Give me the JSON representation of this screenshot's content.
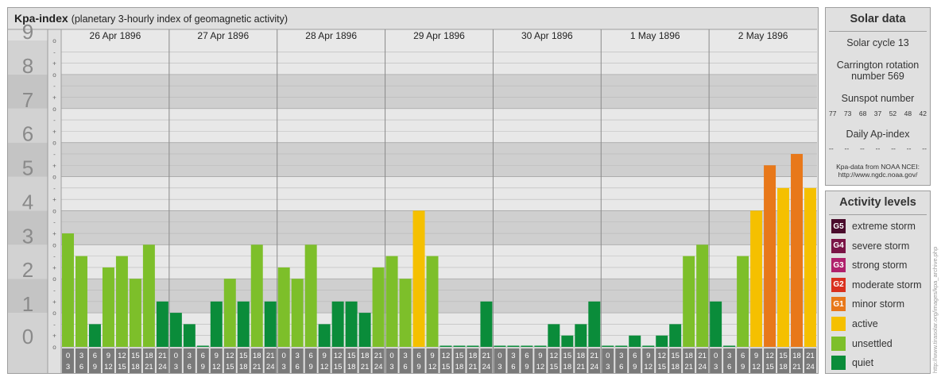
{
  "header": {
    "title": "Kpa-index",
    "subtitle": "(planetary 3-hourly index of geomagnetic activity)"
  },
  "chart_data": {
    "type": "bar",
    "title": "Kpa-index",
    "subtitle": "(planetary 3-hourly index of geomagnetic activity)",
    "ylim": [
      0,
      9
    ],
    "y_ticks": [
      "0",
      "1",
      "2",
      "3",
      "4",
      "5",
      "6",
      "7",
      "8",
      "9"
    ],
    "thirds_marks": [
      "+",
      "o",
      "-"
    ],
    "days": [
      "26 Apr 1896",
      "27 Apr 1896",
      "28 Apr 1896",
      "29 Apr 1896",
      "30 Apr 1896",
      "1 May 1896",
      "2 May 1896"
    ],
    "interval_starts": [
      "0",
      "3",
      "6",
      "9",
      "12",
      "15",
      "18",
      "21"
    ],
    "interval_ends": [
      "3",
      "6",
      "9",
      "12",
      "15",
      "18",
      "21",
      "24"
    ],
    "values": [
      [
        3.333,
        2.667,
        0.667,
        2.333,
        2.667,
        2.0,
        3.0,
        1.333
      ],
      [
        1.0,
        0.667,
        0.0,
        1.333,
        2.0,
        1.333,
        3.0,
        1.333
      ],
      [
        2.333,
        2.0,
        3.0,
        0.667,
        1.333,
        1.333,
        1.0,
        2.333
      ],
      [
        2.667,
        2.0,
        4.0,
        2.667,
        0.0,
        0.0,
        0.0,
        1.333
      ],
      [
        0.0,
        0.0,
        0.0,
        0.0,
        0.667,
        0.333,
        0.667,
        1.333
      ],
      [
        0.0,
        0.0,
        0.333,
        0.0,
        0.333,
        0.667,
        2.667,
        3.0
      ],
      [
        1.333,
        0.0,
        2.667,
        4.0,
        5.333,
        4.667,
        5.667,
        4.667
      ]
    ],
    "grid": true,
    "legend_placement": "right"
  },
  "solar": {
    "title": "Solar data",
    "cycle": "Solar cycle 13",
    "carrington_line1": "Carrington rotation",
    "carrington_line2": "number 569",
    "sunspot_label": "Sunspot number",
    "sunspot_values": [
      "77",
      "73",
      "68",
      "37",
      "52",
      "48",
      "42"
    ],
    "ap_label": "Daily Ap-index",
    "ap_values": [
      "--",
      "--",
      "--",
      "--",
      "--",
      "--",
      "--"
    ],
    "source_line1": "Kpa-data from NOAA NCEI:",
    "source_line2": "http://www.ngdc.noaa.gov/"
  },
  "activity": {
    "title": "Activity levels",
    "levels": [
      {
        "badge": "G5",
        "label": "extreme storm",
        "color": "#4a0c2c"
      },
      {
        "badge": "G4",
        "label": "severe storm",
        "color": "#7a1446"
      },
      {
        "badge": "G3",
        "label": "strong storm",
        "color": "#b0206c"
      },
      {
        "badge": "G2",
        "label": "moderate storm",
        "color": "#d9301e"
      },
      {
        "badge": "G1",
        "label": "minor storm",
        "color": "#e8781a"
      },
      {
        "badge": "",
        "label": "active",
        "color": "#f5c000"
      },
      {
        "badge": "",
        "label": "unsettled",
        "color": "#7dbf2a"
      },
      {
        "badge": "",
        "label": "quiet",
        "color": "#0a8c3a"
      }
    ]
  },
  "colors": {
    "quiet": "#0a8c3a",
    "unsettled": "#7dbf2a",
    "active": "#f5c000",
    "minor_storm": "#e8781a",
    "moderate_storm": "#d9301e",
    "strong_storm": "#b0206c",
    "panel_bg": "#e0e0e0",
    "band_dark": "#cfcfcf",
    "band_light": "#e8e8e8"
  },
  "watermark": "http://www.tirasolar.org/images/kpa_archive.php"
}
